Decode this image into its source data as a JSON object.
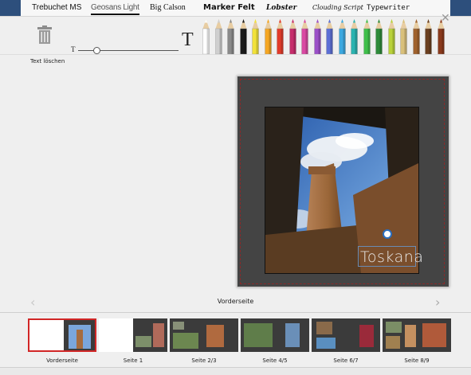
{
  "fonts": [
    {
      "label": "Trebuchet MS",
      "selected": false
    },
    {
      "label": "Geosans Light",
      "selected": true
    },
    {
      "label": "Big Calson",
      "selected": false
    },
    {
      "label": "Marker Felt",
      "selected": false
    },
    {
      "label": "Lobster",
      "selected": false
    },
    {
      "label": "Clouding Script",
      "selected": false
    },
    {
      "label": "Typewriter",
      "selected": false
    }
  ],
  "toolbar": {
    "delete_label": "Text löschen",
    "size_small": "T",
    "size_large": "T",
    "close_glyph": "✕"
  },
  "pencil_colors": [
    "#ffffff",
    "#cfcfcf",
    "#8a8a8a",
    "#1a1a1a",
    "#f2e23a",
    "#f5a623",
    "#e23b2a",
    "#c62d6c",
    "#d94aa3",
    "#9b4fc8",
    "#5c6fd6",
    "#3ba8e0",
    "#2bb3b0",
    "#3fbf4a",
    "#2e8b3a",
    "#b9d23a",
    "#d9c07a",
    "#a0622d",
    "#6b3f1f",
    "#8a3a1c"
  ],
  "preview": {
    "caption": "Toskana"
  },
  "navigation": {
    "prev_glyph": "‹",
    "next_glyph": "›",
    "current_page": "Vorderseite"
  },
  "pages": [
    {
      "label": "Vorderseite",
      "selected": true
    },
    {
      "label": "Seite 1",
      "selected": false
    },
    {
      "label": "Seite 2/3",
      "selected": false
    },
    {
      "label": "Seite 4/5",
      "selected": false
    },
    {
      "label": "Seite 6/7",
      "selected": false
    },
    {
      "label": "Seite 8/9",
      "selected": false
    }
  ]
}
